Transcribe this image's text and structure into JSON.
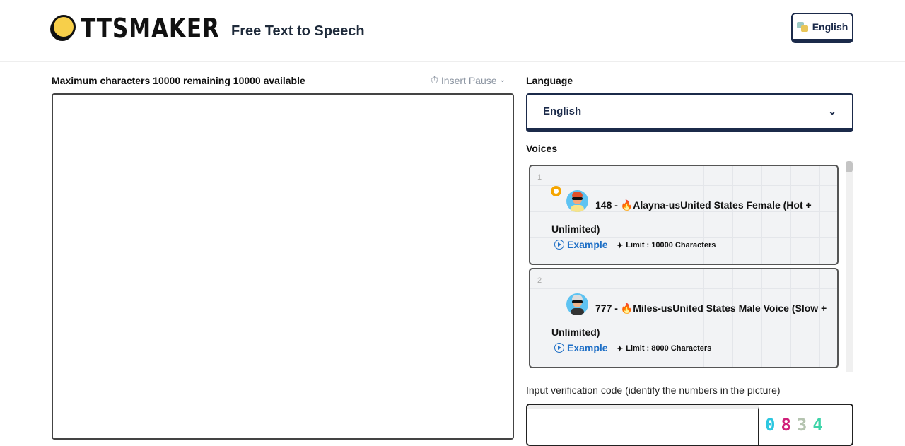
{
  "header": {
    "logo": "TTSMAKER",
    "tagline": "Free Text to Speech",
    "lang_button": "English"
  },
  "editor": {
    "char_info": "Maximum characters 10000 remaining 10000 available",
    "insert_pause": "Insert Pause",
    "text": ""
  },
  "language": {
    "label": "Language",
    "selected": "English"
  },
  "voices": {
    "label": "Voices",
    "items": [
      {
        "index": "1",
        "name": "148 - 🔥Alayna-usUnited States Female (Hot + Unlimited)",
        "example": "Example",
        "limit": "Limit : 10000 Characters",
        "selected": true
      },
      {
        "index": "2",
        "name": "777 - 🔥Miles-usUnited States Male Voice (Slow + Unlimited)",
        "example": "Example",
        "limit": "Limit : 8000 Characters",
        "selected": false
      }
    ]
  },
  "verification": {
    "label": "Input verification code (identify the numbers in the picture)",
    "value": "",
    "captcha_digits": [
      "0",
      "8",
      "3",
      "4"
    ]
  }
}
